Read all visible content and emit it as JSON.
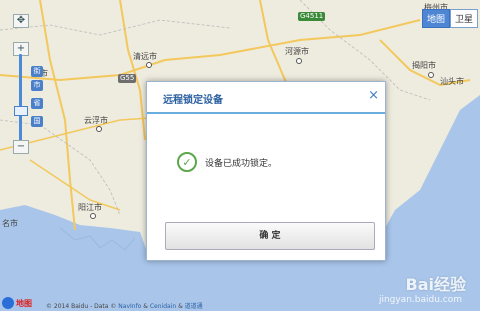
{
  "map": {
    "labels": [
      "清远市",
      "河源市",
      "揭阳市",
      "汕头市",
      "云浮市",
      "阳江市",
      "名市",
      "梅州市",
      "州市"
    ],
    "road_shields": [
      "G4511",
      "G55"
    ],
    "zoom": {
      "plus": "+",
      "minus": "−",
      "level_tags": [
        "街",
        "市",
        "省",
        "国"
      ]
    },
    "map_type": {
      "map": "地图",
      "satellite": "卫星"
    }
  },
  "dialog": {
    "title": "远程锁定设备",
    "close_glyph": "×",
    "message": "设备已成功锁定。",
    "confirm": "确 定"
  },
  "footer": {
    "logo_text": "地图",
    "copyright": "© 2014 Baidu - Data © ",
    "links": [
      "NavInfo",
      "Cenidain",
      "道道通"
    ]
  },
  "watermark": {
    "brand": "Bai经验",
    "url": "jingyan.baidu.com"
  },
  "colors": {
    "land": "#eeebdf",
    "sea": "#a9c6ea",
    "road": "#f3c85c",
    "accent": "#4f86d4"
  }
}
